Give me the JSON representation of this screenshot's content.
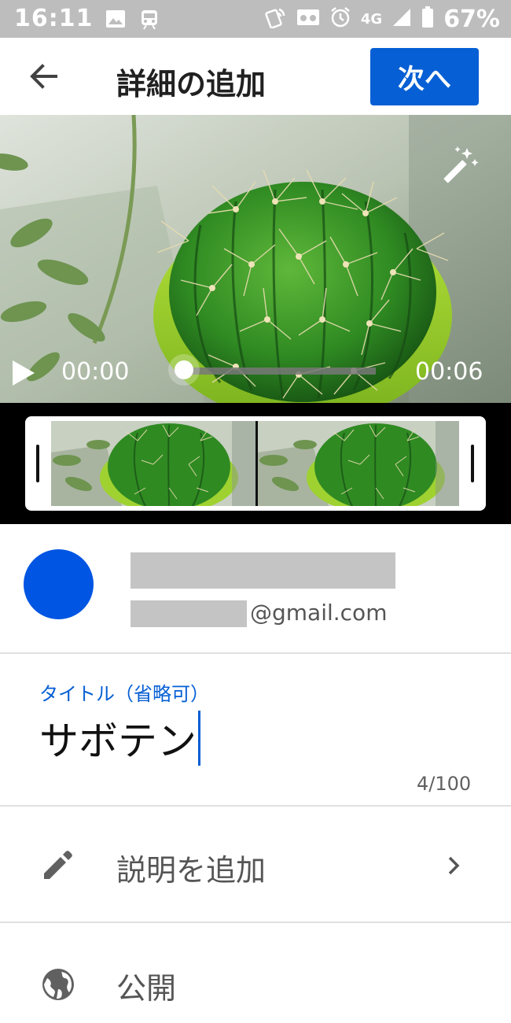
{
  "status_bar": {
    "time": "16:11",
    "network": "4G",
    "battery": "67%",
    "icons": [
      "gallery-icon",
      "train-icon",
      "nfc-icon",
      "voicemail-icon",
      "alarm-icon",
      "signal-icon",
      "battery-icon"
    ]
  },
  "app_bar": {
    "title": "詳細の追加",
    "next_label": "次へ",
    "back_icon": "arrow-left-icon"
  },
  "video": {
    "current_time": "00:00",
    "duration": "00:06",
    "progress": 0,
    "magic_icon": "magic-wand-icon",
    "play_icon": "play-icon"
  },
  "account": {
    "email_suffix": "@gmail.com",
    "avatar_color": "#0055e3"
  },
  "title_field": {
    "label": "タイトル（省略可）",
    "value": "サボテン",
    "count": "4/100"
  },
  "rows": {
    "description": {
      "label": "説明を追加",
      "icon": "pencil-icon"
    },
    "visibility": {
      "label": "公開",
      "icon": "globe-icon"
    }
  },
  "colors": {
    "accent": "#065fd4",
    "status_bar": "#bdbdbd"
  }
}
